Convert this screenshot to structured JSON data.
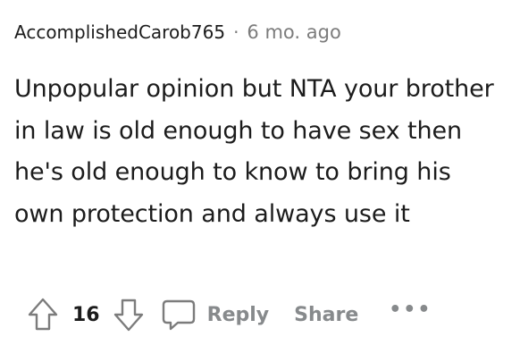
{
  "comment": {
    "author": "AccomplishedCarob765",
    "separator": "·",
    "timestamp": "6 mo. ago",
    "body": "Unpopular opinion but NTA your brother in law is old enough to have sex then he's old enough to know to bring his own protection and always use it",
    "score": "16",
    "reply_label": "Reply",
    "share_label": "Share",
    "more_label": "•••"
  },
  "icons": {
    "upvote": "upvote-arrow-icon",
    "downvote": "downvote-arrow-icon",
    "reply": "speech-bubble-icon"
  },
  "colors": {
    "text": "#1c1c1c",
    "meta": "#7c7c7c",
    "action": "#878a8c"
  }
}
